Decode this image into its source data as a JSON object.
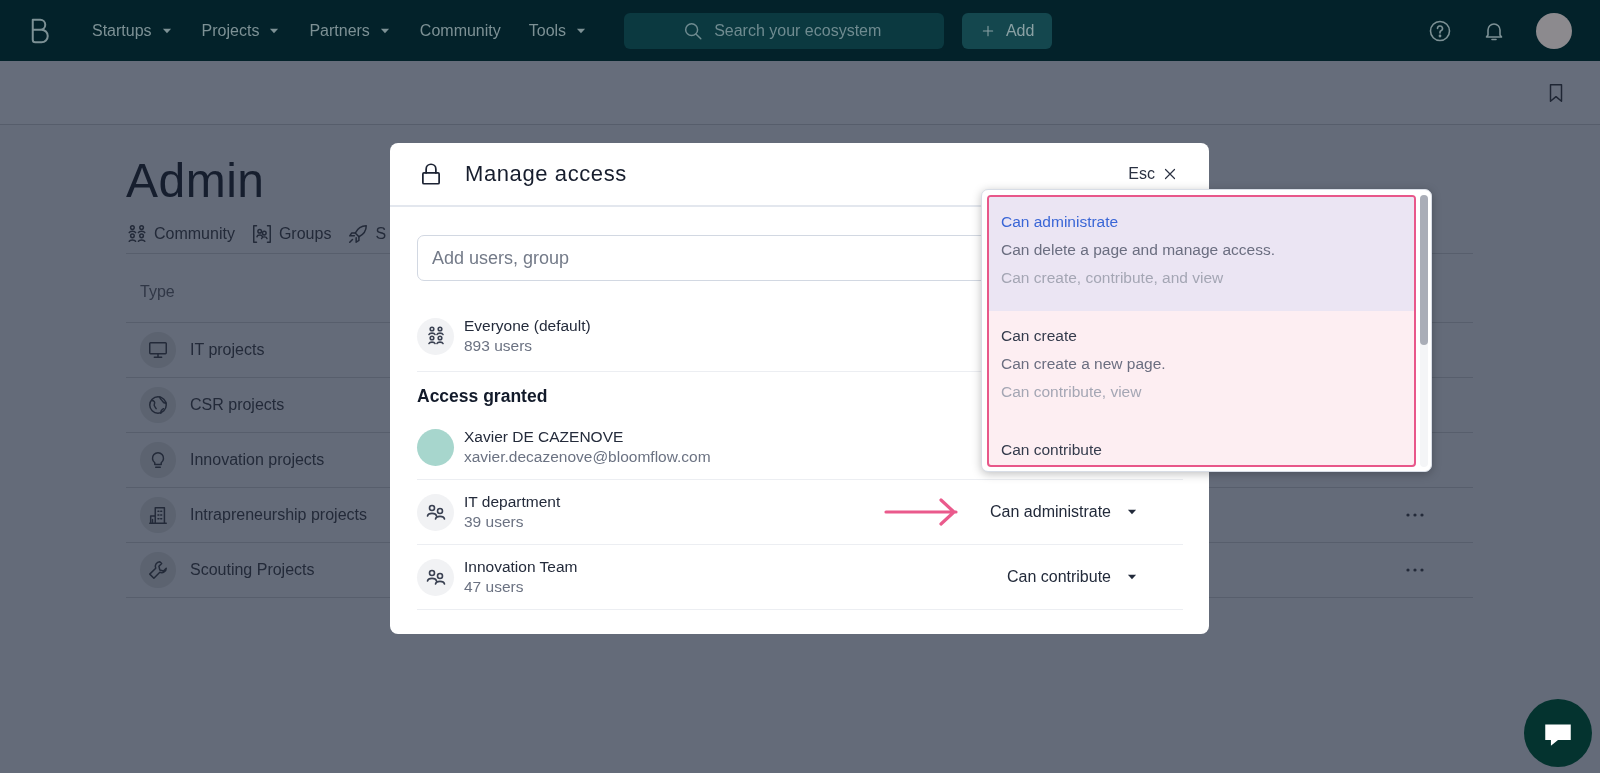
{
  "topbar": {
    "nav": [
      {
        "label": "Startups",
        "has_menu": true
      },
      {
        "label": "Projects",
        "has_menu": true
      },
      {
        "label": "Partners",
        "has_menu": true
      },
      {
        "label": "Community",
        "has_menu": false
      },
      {
        "label": "Tools",
        "has_menu": true
      }
    ],
    "search": {
      "placeholder": "Search your ecosystem"
    },
    "add_button": {
      "label": "Add"
    }
  },
  "page": {
    "title": "Admin",
    "tabs": [
      {
        "label": "Community",
        "kind": "community"
      },
      {
        "label": "Groups",
        "kind": "groups"
      },
      {
        "label": "S",
        "kind": "rocket"
      }
    ],
    "table": {
      "columns": [
        "Type"
      ],
      "rows": [
        {
          "name": "IT projects",
          "kind": "monitor"
        },
        {
          "name": "CSR projects",
          "kind": "globe"
        },
        {
          "name": "Innovation projects",
          "kind": "bulb"
        },
        {
          "name": "Intrapreneurship projects",
          "kind": "building"
        },
        {
          "name": "Scouting Projects",
          "kind": "wrench"
        }
      ]
    }
  },
  "modal": {
    "title": "Manage access",
    "close_label": "Esc",
    "input": {
      "placeholder": "Add users, group"
    },
    "default_entry": {
      "name": "Everyone (default)",
      "detail": "893 users"
    },
    "section_title": "Access granted",
    "members": [
      {
        "kind": "person",
        "name": "Xavier DE CAZENOVE",
        "detail": "xavier.decazenove@bloomflow.com",
        "pointed": false
      },
      {
        "kind": "group",
        "name": "IT department",
        "detail": "39 users",
        "permission": "Can administrate",
        "pointed": true
      },
      {
        "kind": "group",
        "name": "Innovation Team",
        "detail": "47 users",
        "permission": "Can contribute",
        "pointed": false
      }
    ],
    "dropdown": {
      "options": [
        {
          "title": "Can administrate",
          "description": "Can delete a page and manage access.",
          "includes": "Can create, contribute, and view",
          "selected": true
        },
        {
          "title": "Can create",
          "description": "Can create a new page.",
          "includes": "Can contribute, view",
          "selected": false
        },
        {
          "title": "Can contribute",
          "selected": false
        }
      ]
    }
  }
}
